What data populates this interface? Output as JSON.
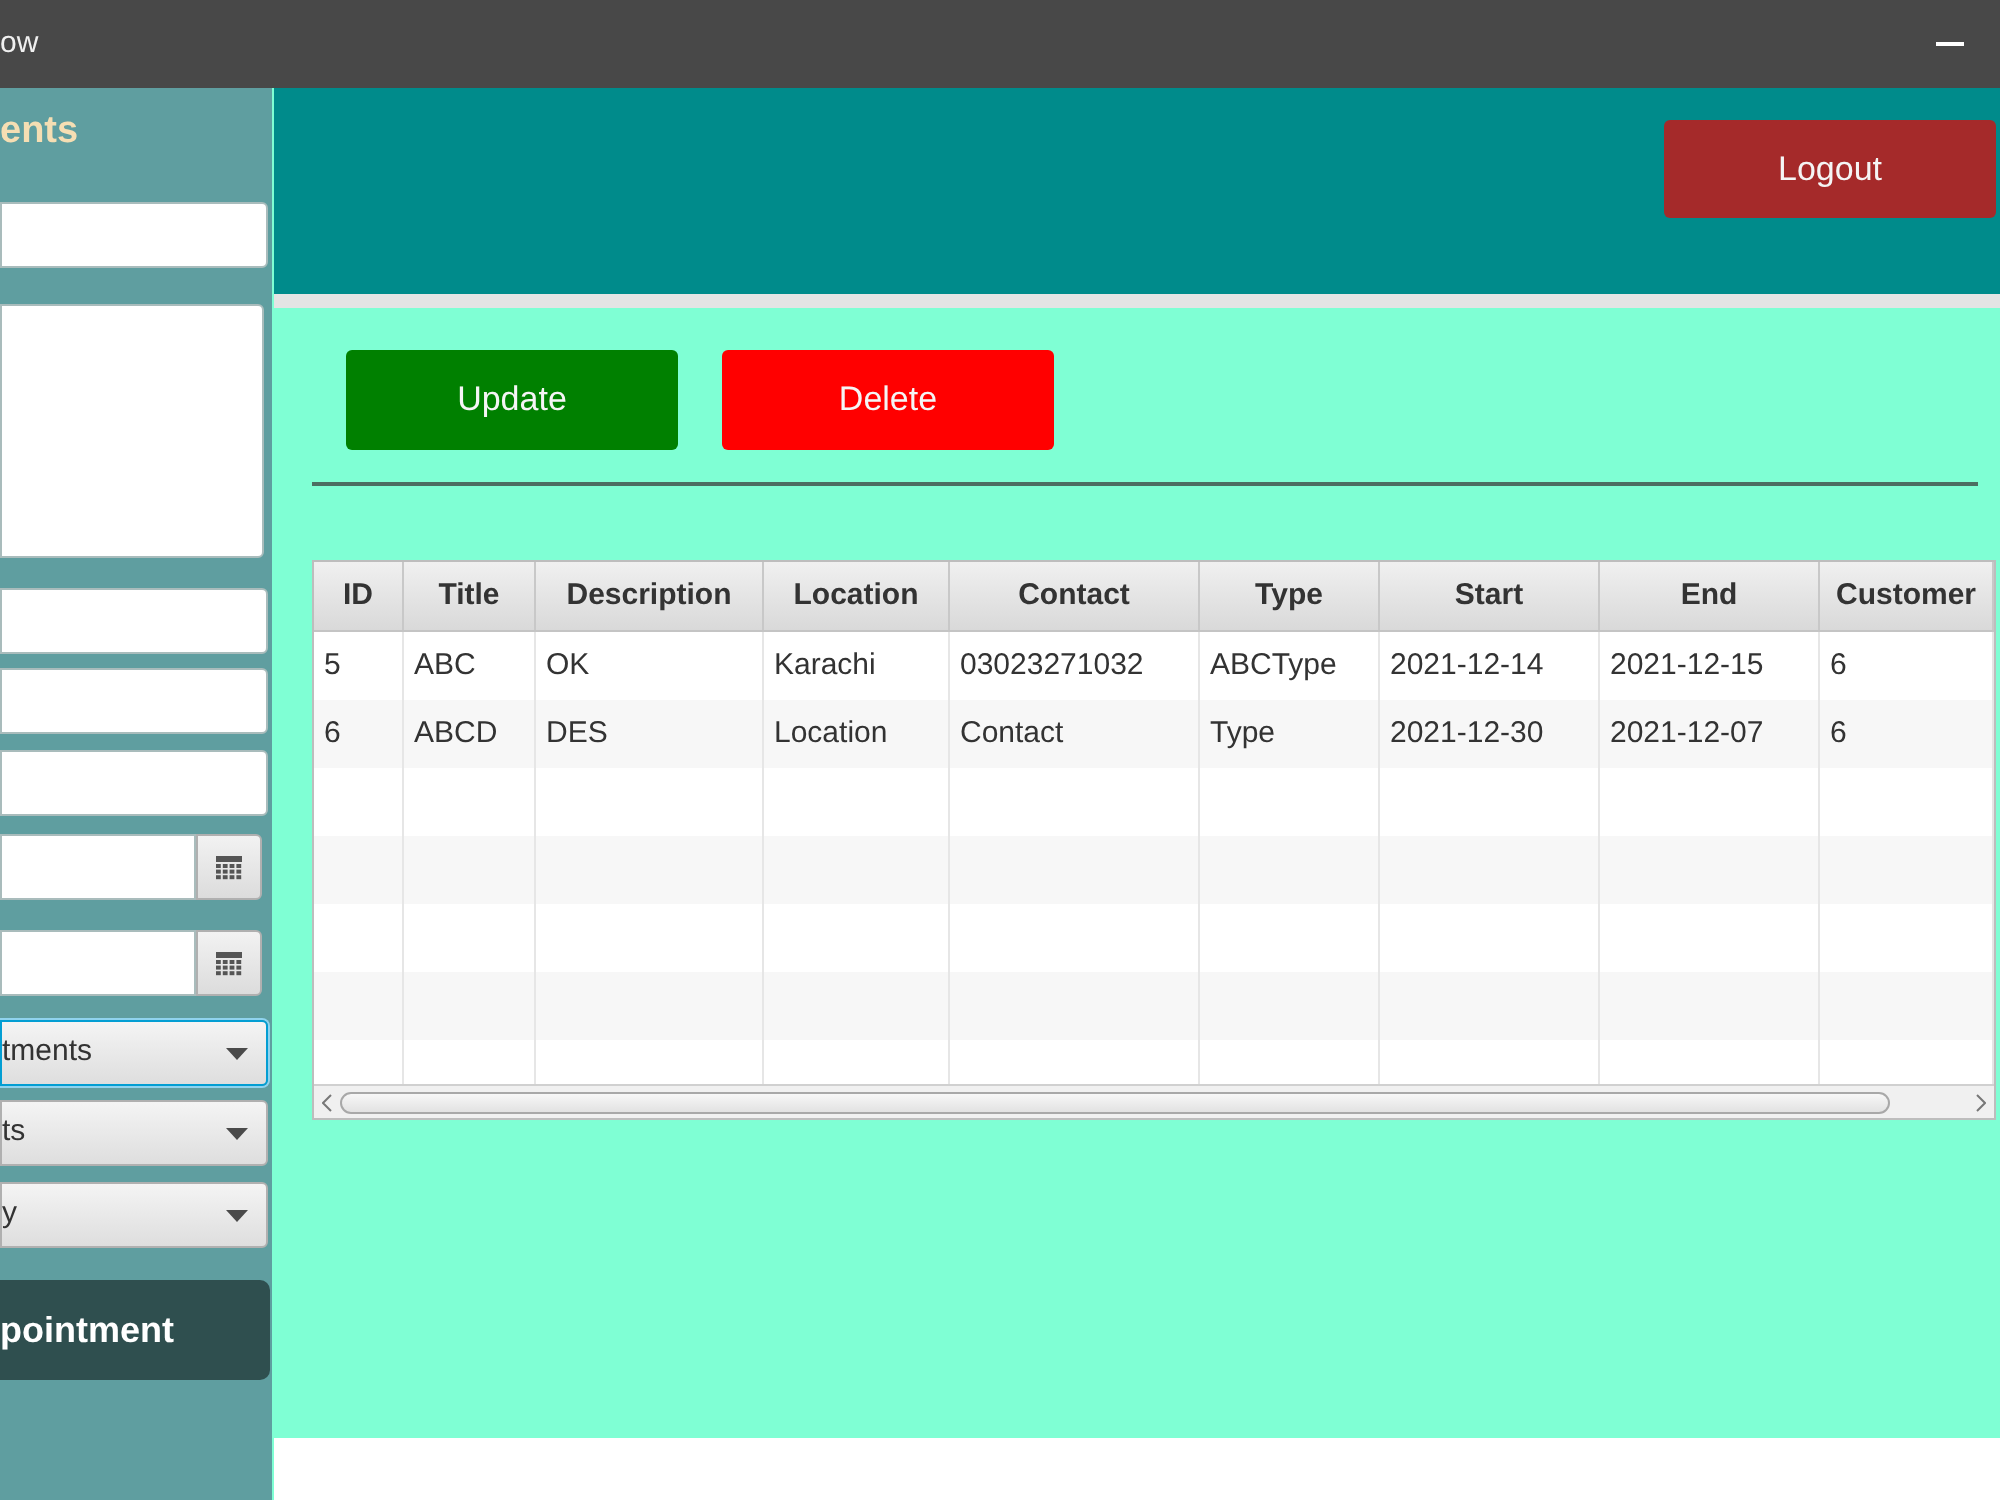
{
  "window": {
    "title": "ow"
  },
  "sidebar": {
    "title": "ents",
    "fields": [
      {
        "kind": "text",
        "focused": false
      },
      {
        "kind": "textarea",
        "focused": false
      },
      {
        "kind": "text",
        "focused": false
      },
      {
        "kind": "text",
        "focused": false
      },
      {
        "kind": "text",
        "focused": false
      },
      {
        "kind": "date",
        "focused": false
      },
      {
        "kind": "date",
        "focused": false
      },
      {
        "kind": "combo",
        "value": "tments",
        "focused": true
      },
      {
        "kind": "combo",
        "value": "ts",
        "focused": false
      },
      {
        "kind": "combo",
        "value": "y",
        "focused": false
      }
    ],
    "button": "pointment"
  },
  "header": {
    "logout": "Logout"
  },
  "actions": [
    {
      "label": "Update",
      "color": "#008000"
    },
    {
      "label": "Delete",
      "color": "#ff0000"
    }
  ],
  "table": {
    "columns": [
      "ID",
      "Title",
      "Description",
      "Location",
      "Contact",
      "Type",
      "Start",
      "End",
      "Customer"
    ],
    "rows": [
      [
        "5",
        "ABC",
        "OK",
        "Karachi",
        "03023271032",
        "ABCType",
        "2021-12-14",
        "2021-12-15",
        "6"
      ],
      [
        "6",
        "ABCD",
        "DES",
        "Location",
        "Contact",
        "Type",
        "2021-12-30",
        "2021-12-07",
        "6"
      ]
    ]
  }
}
